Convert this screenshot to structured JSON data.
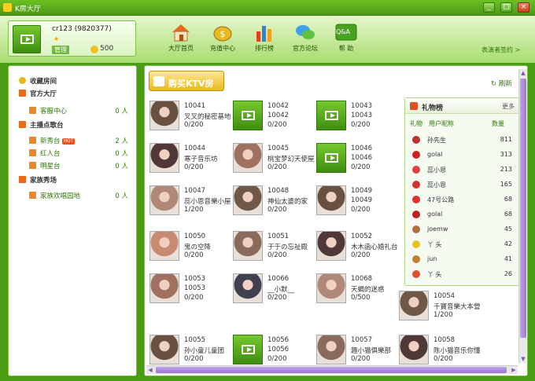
{
  "window": {
    "title": "K房大厅",
    "min": "_",
    "max": "□",
    "close": "×"
  },
  "user": {
    "name": "cr123 (9820377)",
    "role": "管理",
    "coins": "500"
  },
  "nav": [
    {
      "label": "大厅首页"
    },
    {
      "label": "充值中心"
    },
    {
      "label": "排行榜"
    },
    {
      "label": "官方论坛"
    },
    {
      "label": "帮 助",
      "badge": "Q&A"
    }
  ],
  "header_link": "表演者签约 >",
  "sidebar": {
    "favorites": "收藏房间",
    "official": "官方大厅",
    "customer_service": {
      "label": "客服中心",
      "count": "0 人"
    },
    "stages": "主播点歌台",
    "new_show": {
      "label": "新秀台",
      "badge": "HOT",
      "count": "2 人"
    },
    "red": {
      "label": "红人台",
      "count": "0 人"
    },
    "star": {
      "label": "明星台",
      "count": "0 人"
    },
    "family": "家族秀场",
    "family_hall": {
      "label": "家族欢唱园地",
      "count": "0 人"
    }
  },
  "buy_button": "购买KTV房",
  "refresh": "刷新",
  "rooms": [
    {
      "id": "10041",
      "name": "叉叉的秘密基地",
      "occupancy": "0/200",
      "thumb": "photo"
    },
    {
      "id": "10042",
      "name": "10042",
      "occupancy": "0/200",
      "thumb": "default"
    },
    {
      "id": "10043",
      "name": "10043",
      "occupancy": "0/200",
      "thumb": "default"
    },
    {
      "id": "10044",
      "name": "寒子音乐坊",
      "occupancy": "0/200",
      "thumb": "photo"
    },
    {
      "id": "10045",
      "name": "桃宝梦幻天使屋",
      "occupancy": "0/200",
      "thumb": "photo"
    },
    {
      "id": "10046",
      "name": "10046",
      "occupancy": "0/200",
      "thumb": "default"
    },
    {
      "id": "10047",
      "name": "蕊小恩音樂小屋",
      "occupancy": "1/200",
      "thumb": "photo"
    },
    {
      "id": "10048",
      "name": "神仙太婆的家",
      "occupancy": "0/200",
      "thumb": "photo"
    },
    {
      "id": "10049",
      "name": "10049",
      "occupancy": "0/200",
      "thumb": "photo"
    },
    {
      "id": "10050",
      "name": "鬼の空降",
      "occupancy": "0/200",
      "thumb": "photo"
    },
    {
      "id": "10051",
      "name": "于于の忘祉殿",
      "occupancy": "0/200",
      "thumb": "photo"
    },
    {
      "id": "10052",
      "name": "木木函心婚礼台",
      "occupancy": "0/200",
      "thumb": "photo"
    },
    {
      "id": "10053",
      "name": "10053",
      "occupancy": "0/200",
      "thumb": "photo"
    },
    {
      "id": "10066",
      "name": "__小默__",
      "occupancy": "0/200",
      "thumb": "photo"
    },
    {
      "id": "10068",
      "name": "天蝎的迷惑",
      "occupancy": "0/500",
      "thumb": "photo"
    },
    {
      "id": "10054",
      "name": "千寶音樂大本營",
      "occupancy": "1/200",
      "thumb": "photo"
    },
    {
      "id": "10055",
      "name": "孙小童儿童团",
      "occupancy": "0/200",
      "thumb": "photo"
    },
    {
      "id": "10056",
      "name": "10056",
      "occupancy": "0/200",
      "thumb": "default"
    },
    {
      "id": "10057",
      "name": "趣小猫俱樂部",
      "occupancy": "0/200",
      "thumb": "photo"
    },
    {
      "id": "10058",
      "name": "陈小猫音乐你懂",
      "occupancy": "0/200",
      "thumb": "photo"
    }
  ],
  "gift": {
    "title": "礼物榜",
    "more": "更多",
    "col_gift": "礼物",
    "col_user": "用户昵称",
    "col_count": "数量",
    "rows": [
      {
        "user": "孙先生",
        "count": "811",
        "icon": "#c03030"
      },
      {
        "user": "golal",
        "count": "313",
        "icon": "#d02020"
      },
      {
        "user": "蕊小恩",
        "count": "213",
        "icon": "#e04040"
      },
      {
        "user": "蕊小恩",
        "count": "165",
        "icon": "#d83030"
      },
      {
        "user": "47号公路",
        "count": "68",
        "icon": "#e03030"
      },
      {
        "user": "golal",
        "count": "68",
        "icon": "#c02020"
      },
      {
        "user": "joemw",
        "count": "45",
        "icon": "#b07040"
      },
      {
        "user": "丫 头",
        "count": "42",
        "icon": "#e8c020"
      },
      {
        "user": "jun",
        "count": "41",
        "icon": "#c08030"
      },
      {
        "user": "丫 头",
        "count": "26",
        "icon": "#e05030"
      }
    ]
  },
  "colors": {
    "accent": "#4a9c12",
    "link": "#2f7a08",
    "scroll": "#9c7ad0"
  }
}
